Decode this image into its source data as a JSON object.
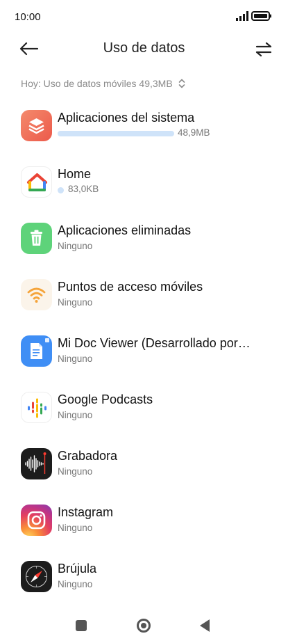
{
  "status": {
    "time": "10:00"
  },
  "header": {
    "title": "Uso de datos"
  },
  "filter": {
    "label": "Hoy: Uso de datos móviles 49,3MB"
  },
  "apps": [
    {
      "name": "Aplicaciones del sistema",
      "usage": "48,9MB",
      "usage_fraction": 1.0,
      "icon": "layers-icon",
      "icon_color": "#f06c55"
    },
    {
      "name": "Home",
      "usage": "83,0KB",
      "icon": "google-home-icon"
    },
    {
      "name": "Aplicaciones eliminadas",
      "status": "Ninguno",
      "icon": "trash-icon",
      "icon_color": "#5ed37a"
    },
    {
      "name": "Puntos de acceso móviles",
      "status": "Ninguno",
      "icon": "wifi-hotspot-icon",
      "icon_color": "#f5a43a"
    },
    {
      "name": "Mi Doc Viewer (Desarrollado por…",
      "status": "Ninguno",
      "icon": "document-icon",
      "icon_color": "#3f8ef5"
    },
    {
      "name": "Google Podcasts",
      "status": "Ninguno",
      "icon": "podcasts-icon"
    },
    {
      "name": "Grabadora",
      "status": "Ninguno",
      "icon": "waveform-icon",
      "icon_color": "#1c1c1c"
    },
    {
      "name": "Instagram",
      "status": "Ninguno",
      "icon": "instagram-icon"
    },
    {
      "name": "Brújula",
      "status": "Ninguno",
      "icon": "compass-icon",
      "icon_color": "#1c1c1c"
    }
  ],
  "colors": {
    "usage_bar": "#cfe3f9",
    "secondary_text": "#777777"
  }
}
